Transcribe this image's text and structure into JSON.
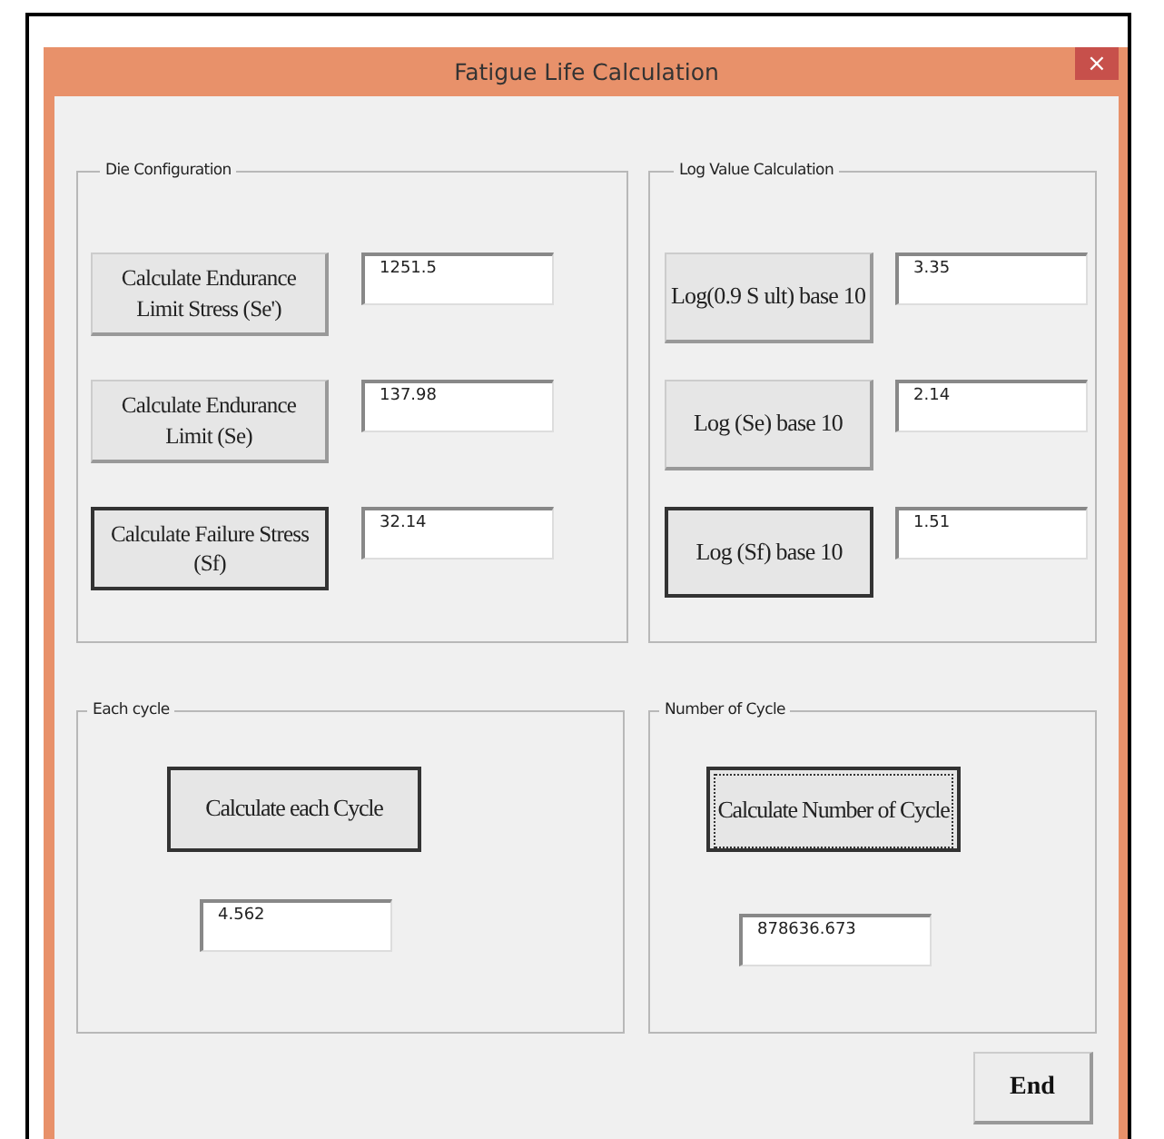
{
  "window": {
    "title": "Fatigue Life Calculation",
    "close": "×"
  },
  "groups": [
    {
      "legend": "Die Configuration",
      "rows": [
        {
          "button": "Calculate Endurance Limit Stress (Se')",
          "value": "1251.5",
          "emphasized": false
        },
        {
          "button": "Calculate Endurance Limit (Se)",
          "value": "137.98",
          "emphasized": false
        },
        {
          "button": "Calculate Failure Stress (Sf)",
          "value": "32.14",
          "emphasized": true
        }
      ]
    },
    {
      "legend": "Log Value Calculation",
      "rows": [
        {
          "button": "Log(0.9 S ult) base 10",
          "value": "3.35",
          "emphasized": false
        },
        {
          "button": "Log (Se) base 10",
          "value": "2.14",
          "emphasized": false
        },
        {
          "button": "Log (Sf) base 10",
          "value": "1.51",
          "emphasized": true
        }
      ]
    }
  ],
  "each_cycle": {
    "legend": "Each cycle",
    "button": "Calculate each Cycle",
    "value": "4.562",
    "emphasized": true,
    "focused": false
  },
  "number_of_cycle": {
    "legend": "Number of Cycle",
    "button": "Calculate Number of Cycle",
    "value": "878636.673",
    "emphasized": true,
    "focused": true
  },
  "end_button": "End"
}
